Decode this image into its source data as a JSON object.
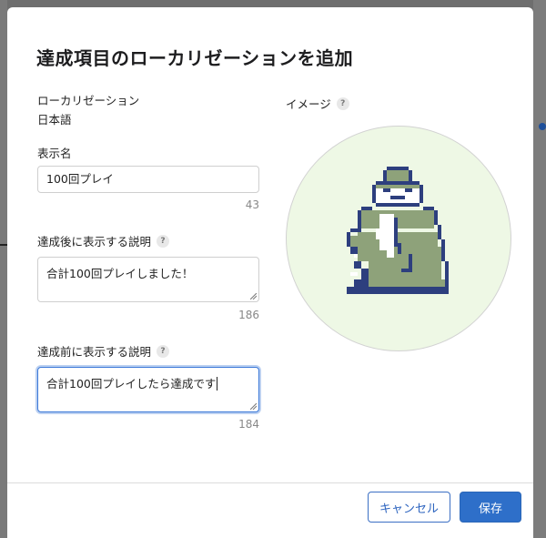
{
  "dialog": {
    "title": "達成項目のローカリゼーションを追加"
  },
  "localization": {
    "label": "ローカリゼーション",
    "value": "日本語"
  },
  "display_name": {
    "label": "表示名",
    "value": "100回プレイ",
    "remaining": "43"
  },
  "after_description": {
    "label": "達成後に表示する説明",
    "help": "?",
    "value": "合計100回プレイしました！",
    "remaining": "186"
  },
  "before_description": {
    "label": "達成前に表示する説明",
    "help": "?",
    "value": "合計100回プレイしたら達成です",
    "remaining": "184"
  },
  "image": {
    "label": "イメージ",
    "help": "?",
    "icon": "pixel-art-character-icon",
    "colors": {
      "outline": "#2d3f7e",
      "fill": "#8ea27a",
      "highlight": "#ffffff",
      "background": "#eef8e5"
    }
  },
  "buttons": {
    "cancel": "キャンセル",
    "save": "保存"
  },
  "accent_color": "#2e6fc9"
}
